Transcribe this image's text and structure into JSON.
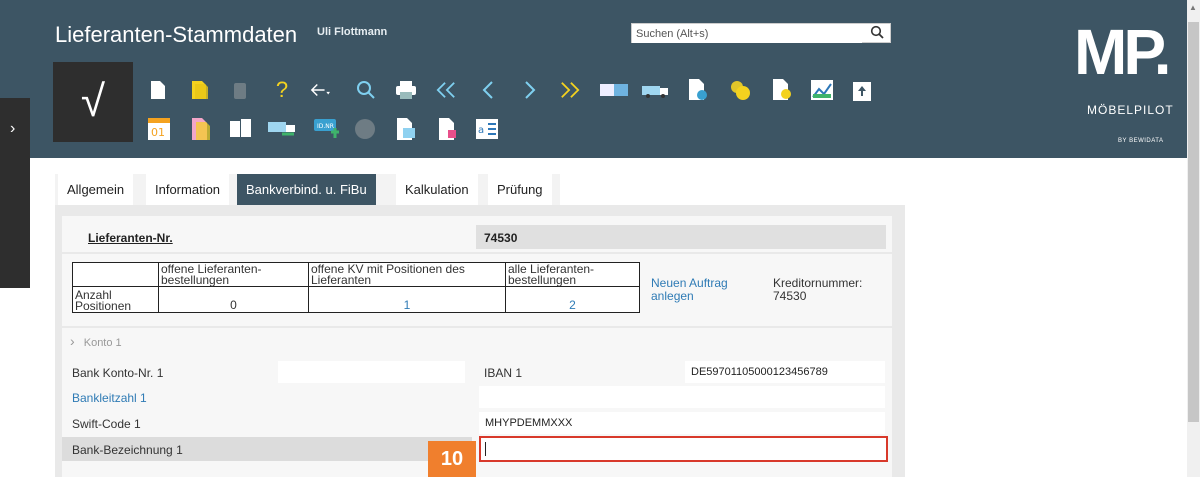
{
  "header": {
    "title": "Lieferanten-Stammdaten",
    "user": "Uli Flottmann",
    "search_placeholder": "Suchen (Alt+s)",
    "confirm_symbol": "√",
    "side_toggle": "›",
    "toolbar_calendar_label": "01",
    "toolbar_idnr_label": "ID.NR",
    "toolbar_doc_label": "a"
  },
  "logo": {
    "mark": "MP.",
    "name": "MÖBELPILOT",
    "sub": "BY BEWIDATA"
  },
  "tabs": [
    {
      "label": "Allgemein",
      "active": false
    },
    {
      "label": "Information",
      "active": false
    },
    {
      "label": "Bankverbind. u. FiBu",
      "active": true
    },
    {
      "label": "Kalkulation",
      "active": false
    },
    {
      "label": "Prüfung",
      "active": false
    }
  ],
  "supplier": {
    "number_label": "Lieferanten-Nr.",
    "number_value": "74530"
  },
  "stats": {
    "row_label": "Anzahl Positionen",
    "col1_header": "offene Lieferanten-bestellungen",
    "col1_value": "0",
    "col2_header": "offene KV mit Positionen des Lieferanten",
    "col2_value": "1",
    "col3_header": "alle Lieferanten-bestellungen",
    "col3_value": "2",
    "new_order_link": "Neuen Auftrag anlegen",
    "creditor_label": "Kreditornummer:",
    "creditor_value": "74530"
  },
  "konto": {
    "section_label": "Konto 1",
    "bank_konto_label": "Bank Konto-Nr. 1",
    "bank_konto_value": "",
    "iban_label": "IBAN 1",
    "iban_value": "DE59701105000123456789",
    "blz_label": "Bankleitzahl 1",
    "blz_value": "",
    "swift_label": "Swift-Code 1",
    "swift_value": "MHYPDEMMXXX",
    "bank_name_label": "Bank-Bezeichnung 1",
    "bank_name_value": ""
  },
  "step_badge": "10"
}
